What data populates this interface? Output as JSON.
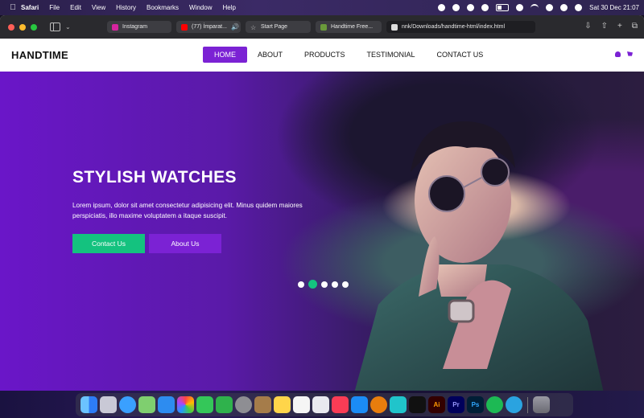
{
  "menubar": {
    "app": "Safari",
    "items": [
      "File",
      "Edit",
      "View",
      "History",
      "Bookmarks",
      "Window",
      "Help"
    ],
    "clock": "Sat 30 Dec  21:07"
  },
  "browser": {
    "tabs": [
      {
        "label": "Instagram",
        "favicon_color": "#d6249f"
      },
      {
        "label": "(77) İmparat...",
        "favicon_color": "#ff0000"
      },
      {
        "label": "Start Page",
        "favicon_color": "#cccccc"
      },
      {
        "label": "Handtime Free...",
        "favicon_color": "#6a9a3a"
      },
      {
        "label": "nnk/Downloads/handtime-html/index.html",
        "favicon_color": "#dddddd"
      }
    ]
  },
  "site": {
    "logo": "HANDTIME",
    "nav": [
      "HOME",
      "ABOUT",
      "PRODUCTS",
      "TESTIMONIAL",
      "CONTACT US"
    ],
    "accent": "#7b22d4",
    "green": "#14c27f"
  },
  "hero": {
    "title": "STYLISH WATCHES",
    "text": "Lorem ipsum, dolor sit amet consectetur adipisicing elit. Minus quidem maiores perspiciatis, illo maxime voluptatem a itaque suscipit.",
    "btn_contact": "Contact Us",
    "btn_about": "About Us",
    "slides": 5,
    "active_slide": 2
  },
  "dock": {
    "apps": [
      "Finder",
      "Launchpad",
      "Safari",
      "Maps",
      "Mail",
      "Photos",
      "Messages",
      "FaceTime",
      "System Settings",
      "Notes Folder",
      "Notes",
      "Reminders",
      "Freeform",
      "Music",
      "App Store",
      "Blender",
      "Canva",
      "CapCut",
      "Illustrator",
      "Premiere Pro",
      "Photoshop",
      "Spotify",
      "Telegram",
      "Trash"
    ],
    "labels": {
      "ai": "Ai",
      "pr": "Pr",
      "ps": "Ps"
    }
  }
}
